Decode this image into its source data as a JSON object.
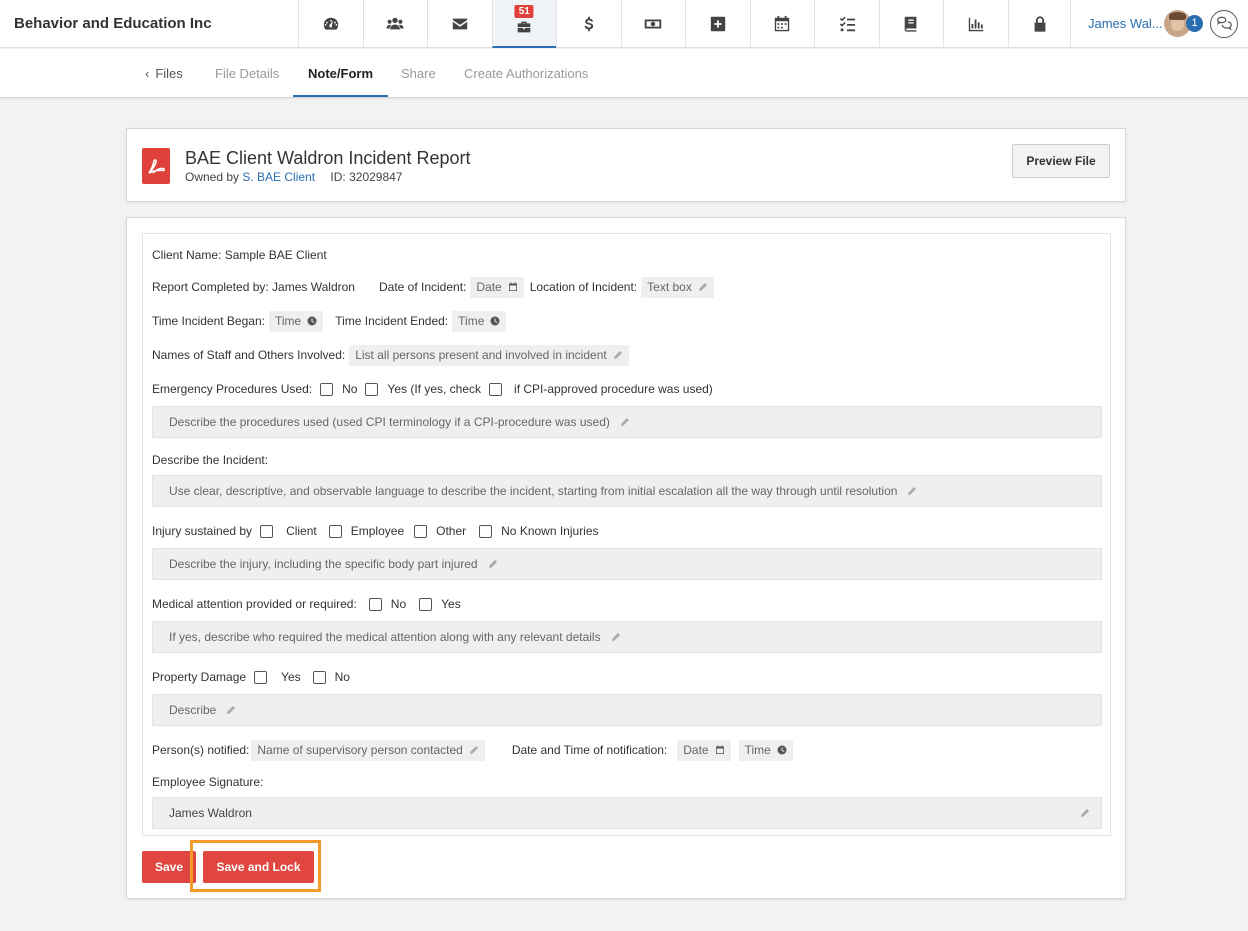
{
  "app": {
    "title": "Behavior and Education Inc",
    "nav": [
      {
        "name": "dashboard-icon"
      },
      {
        "name": "users-icon"
      },
      {
        "name": "mail-icon"
      },
      {
        "name": "briefcase-icon",
        "badge": "51",
        "active": true
      },
      {
        "name": "dollar-icon"
      },
      {
        "name": "money-icon"
      },
      {
        "name": "plus-square-icon"
      },
      {
        "name": "calendar-icon"
      },
      {
        "name": "tasks-icon"
      },
      {
        "name": "book-icon"
      },
      {
        "name": "bar-chart-icon"
      },
      {
        "name": "lock-icon"
      }
    ],
    "user": {
      "name": "James Wal...",
      "badge": "1"
    },
    "accent": "#2a6db0",
    "danger": "#e0463f",
    "highlight": "#f39a2a"
  },
  "subnav": {
    "back": "Files",
    "tabs": [
      "File Details",
      "Note/Form",
      "Share",
      "Create Authorizations"
    ],
    "active": "Note/Form"
  },
  "doc": {
    "title": "BAE Client Waldron Incident Report",
    "owned_prefix": "Owned by",
    "owner": "S. BAE Client",
    "id_text": "ID: 32029847",
    "preview_label": "Preview File"
  },
  "form": {
    "client_name": "Client Name: Sample BAE Client",
    "completed_by": "Report Completed by: James Waldron",
    "date_incident_label": "Date of Incident:",
    "date_ph": "Date",
    "location_label": "Location of Incident:",
    "location_ph": "Text box",
    "time_began_label": "Time Incident Began:",
    "time_ended_label": "Time Incident Ended:",
    "time_ph": "Time",
    "staff_label": "Names of Staff and Others Involved:",
    "staff_ph": "List all persons present and involved in incident",
    "emergency_label": "Emergency Procedures Used:",
    "emergency_no": "No",
    "emergency_yes": "Yes (If yes, check",
    "emergency_cpi": "if CPI-approved procedure was used)",
    "procedures_ph": "Describe the procedures used (used CPI terminology if a CPI-procedure was used)",
    "describe_label": "Describe the Incident:",
    "describe_ph": "Use clear, descriptive, and observable language to describe the incident, starting from initial escalation all the way through until resolution",
    "injury_label": "Injury sustained by",
    "injury_client": "Client",
    "injury_employee": "Employee",
    "injury_other": "Other",
    "injury_none": "No Known Injuries",
    "injury_ph": "Describe the injury, including the specific body part injured",
    "medical_label": "Medical attention provided or required:",
    "medical_no": "No",
    "medical_yes": "Yes",
    "medical_ph": "If yes, describe who required the medical attention along with any relevant details",
    "property_label": "Property Damage",
    "property_yes": "Yes",
    "property_no": "No",
    "property_ph": "Describe",
    "notified_label": "Person(s) notified:",
    "notified_ph": "Name of supervisory person contacted",
    "notify_dt_label": "Date and Time of notification:",
    "signature_label": "Employee Signature:",
    "signature_value": "James Waldron"
  },
  "actions": {
    "save": "Save",
    "save_lock": "Save and Lock"
  }
}
